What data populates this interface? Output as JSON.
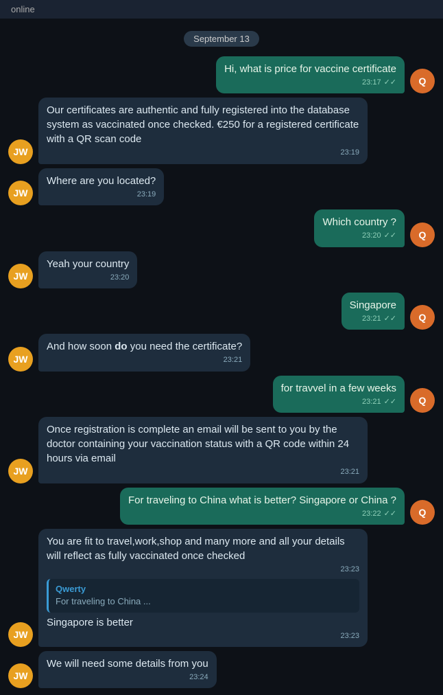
{
  "status": {
    "label": "online"
  },
  "date_badge": "September 13",
  "messages": [
    {
      "id": "msg1",
      "type": "sent",
      "sender": "Q",
      "avatar_class": "q",
      "text": "Hi, what is price for vaccine certificate",
      "time": "23:17",
      "checks": "✓✓"
    },
    {
      "id": "msg2",
      "type": "received",
      "sender": "JW",
      "avatar_class": "jw",
      "text": "Our certificates are authentic and fully registered into the database system as vaccinated once checked. €250 for a registered certificate with a QR scan code",
      "time": "23:19",
      "checks": ""
    },
    {
      "id": "msg3",
      "type": "received",
      "sender": "JW",
      "avatar_class": "jw",
      "text": "Where are you located?",
      "time": "23:19",
      "checks": ""
    },
    {
      "id": "msg4",
      "type": "sent",
      "sender": "Q",
      "avatar_class": "q",
      "text": "Which country ?",
      "time": "23:20",
      "checks": "✓✓"
    },
    {
      "id": "msg5",
      "type": "received",
      "sender": "JW",
      "avatar_class": "jw",
      "text": "Yeah your country",
      "time": "23:20",
      "checks": ""
    },
    {
      "id": "msg6",
      "type": "sent",
      "sender": "Q",
      "avatar_class": "q",
      "text": "Singapore",
      "time": "23:21",
      "checks": "✓✓"
    },
    {
      "id": "msg7",
      "type": "received",
      "sender": "JW",
      "avatar_class": "jw",
      "text": "And how soon do you need the certificate?",
      "time": "23:21",
      "checks": ""
    },
    {
      "id": "msg8",
      "type": "sent",
      "sender": "Q",
      "avatar_class": "q",
      "text": "for travvel in a few weeks",
      "time": "23:21",
      "checks": "✓✓"
    },
    {
      "id": "msg9",
      "type": "received",
      "sender": "JW",
      "avatar_class": "jw",
      "text": "Once registration is complete an email will be sent to you by the doctor containing your vaccination status with a QR code within 24 hours via email",
      "time": "23:21",
      "checks": ""
    },
    {
      "id": "msg10",
      "type": "sent",
      "sender": "Q",
      "avatar_class": "q",
      "text": "For traveling to China what is better? Singapore or China ?",
      "time": "23:22",
      "checks": "✓✓"
    },
    {
      "id": "msg11",
      "type": "received",
      "sender": "JW",
      "avatar_class": "jw",
      "text": "You are fit to travel,work,shop and many more and all your details will reflect as fully vaccinated once checked",
      "time": "23:23",
      "checks": "",
      "reply": {
        "name": "Qwerty",
        "text": "For traveling to China ..."
      },
      "reply_extra": "Singapore is better"
    },
    {
      "id": "msg12",
      "type": "received",
      "sender": "JW",
      "avatar_class": "jw",
      "text": "We will need some details from you",
      "time": "23:24",
      "checks": ""
    }
  ]
}
